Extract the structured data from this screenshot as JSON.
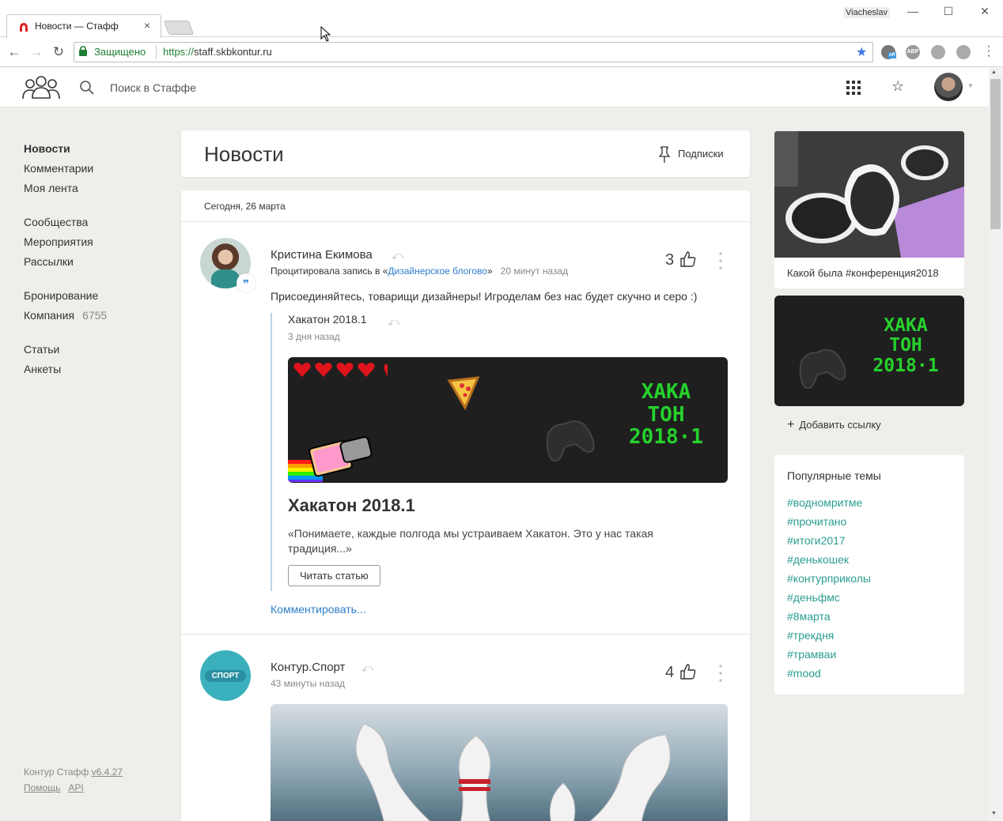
{
  "browser": {
    "tab_title": "Новости — Стафф",
    "tab_close": "×",
    "profile_name": "Viacheslav",
    "secure_label": "Защищено",
    "url_proto": "https://",
    "url_host": "staff.skbkontur.ru",
    "ext_abp": "ABP",
    "ext_off": "off"
  },
  "header": {
    "search_placeholder": "Поиск в Стаффе"
  },
  "sidebar": {
    "groups": [
      [
        {
          "label": "Новости",
          "active": true
        },
        {
          "label": "Комментарии"
        },
        {
          "label": "Моя лента"
        }
      ],
      [
        {
          "label": "Сообщества"
        },
        {
          "label": "Мероприятия"
        },
        {
          "label": "Рассылки"
        }
      ],
      [
        {
          "label": "Бронирование"
        },
        {
          "label": "Компания",
          "count": "6755"
        }
      ],
      [
        {
          "label": "Статьи"
        },
        {
          "label": "Анкеты"
        }
      ]
    ],
    "footer": {
      "product": "Контур Стафф",
      "version": "v6.4.27",
      "help": "Помощь",
      "api": "API"
    }
  },
  "news": {
    "title": "Новости",
    "subscriptions": "Подписки",
    "date": "Сегодня, 26 марта"
  },
  "posts": [
    {
      "author": "Кристина Екимова",
      "action": "Процитировала запись в «",
      "community": "Дизайнерское блогово",
      "action_end": "»",
      "time": "20 минут назад",
      "likes": "3",
      "text": "Присоединяйтесь, товарищи дизайнеры! Игроделам без нас будет скучно и серо :)",
      "quote": {
        "title": "Хакатон 2018.1",
        "time": "3 дня назад",
        "banner_lines": [
          "ХАКА",
          "ТОН",
          "2018·1"
        ],
        "article_title": "Хакатон 2018.1",
        "excerpt": "«Понимаете, каждые полгода мы устраиваем Хакатон. Это у нас такая традиция...»",
        "read_button": "Читать статью"
      },
      "comment_link": "Комментировать..."
    },
    {
      "author": "Контур.Спорт",
      "avatar_text": "СПОРТ",
      "time": "43 минуты назад",
      "likes": "4"
    }
  ],
  "right": {
    "promo1_caption": "Какой была #конференция2018",
    "promo2_lines": [
      "ХАКА",
      "ТОН",
      "2018·1"
    ],
    "add_link": "Добавить ссылку",
    "topics_title": "Популярные темы",
    "topics": [
      "#водномритме",
      "#прочитано",
      "#итоги2017",
      "#денькошек",
      "#контурприколы",
      "#деньфмс",
      "#8марта",
      "#трекдня",
      "#трамваи",
      "#mood"
    ]
  },
  "colors": {
    "accent_teal": "#2a9d8f",
    "link_blue": "#2d7dc9",
    "hack_green": "#26d12c",
    "secure_green": "#1e7e34"
  }
}
